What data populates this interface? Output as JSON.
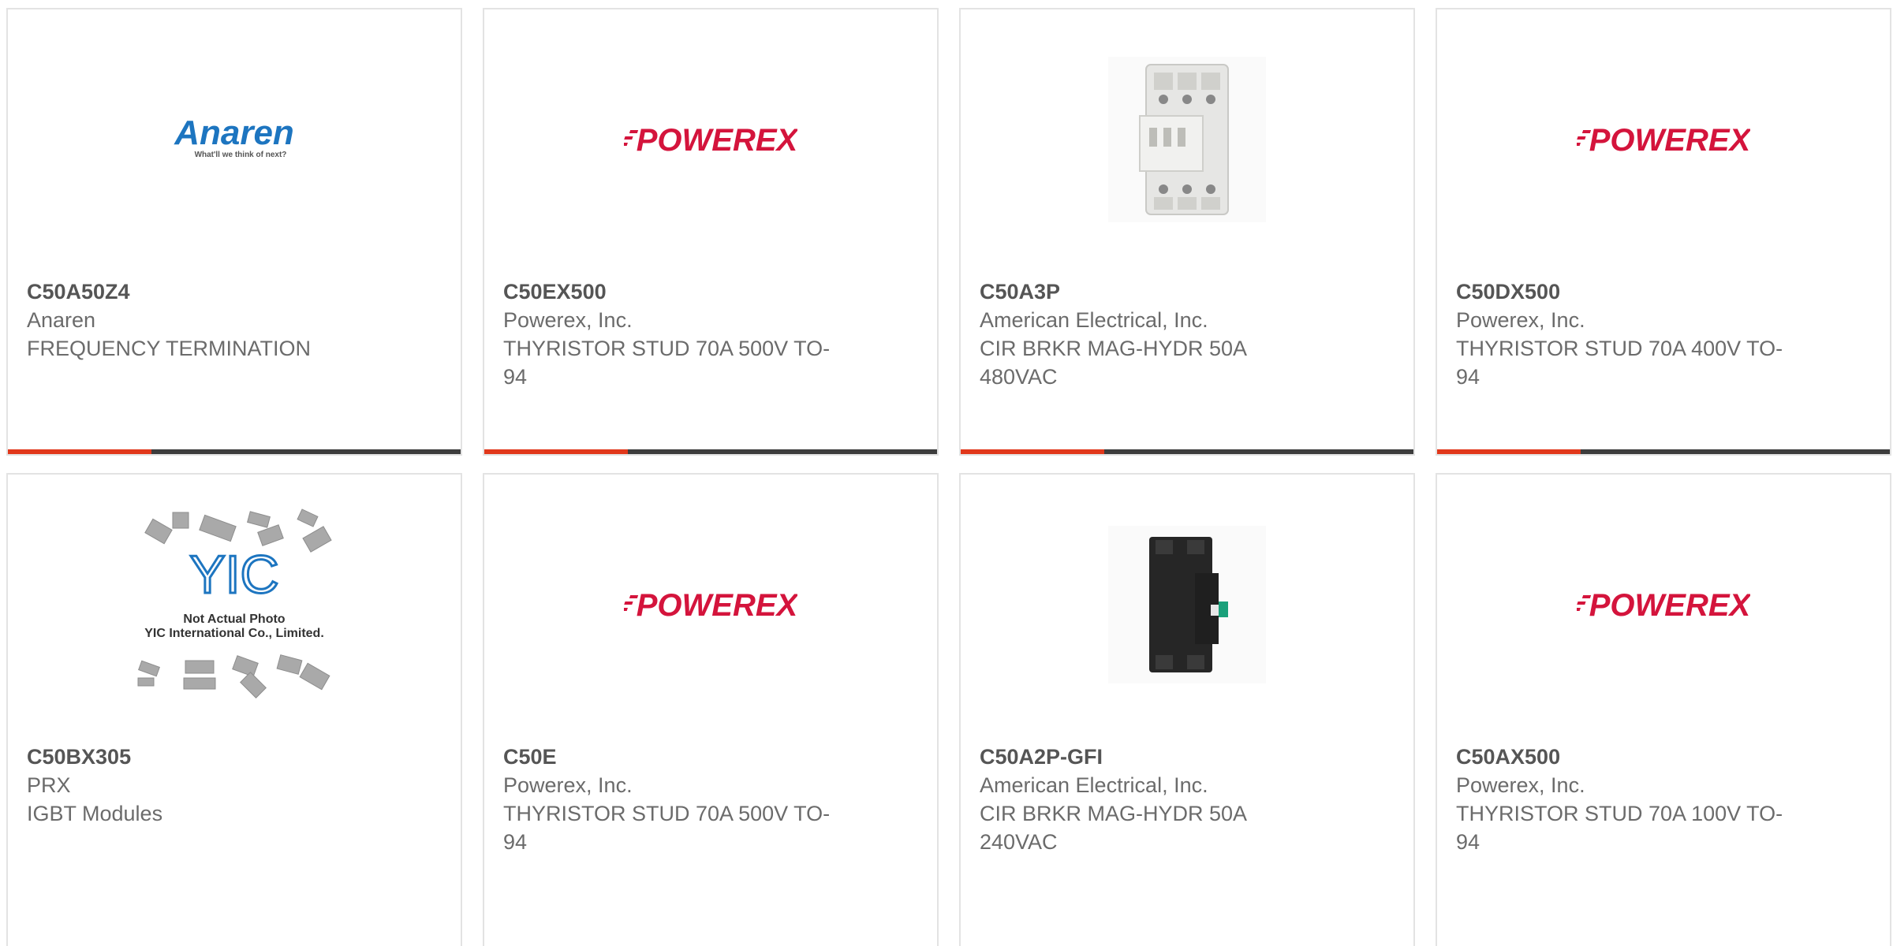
{
  "colors": {
    "accent": "#e1381b",
    "bar": "#3d3d3d",
    "border": "#e3e3e3",
    "powerex_red": "#d4143c",
    "anaren_blue": "#1d75c0"
  },
  "products": [
    {
      "part_number": "C50A50Z4",
      "manufacturer": "Anaren",
      "description": "FREQUENCY TERMINATION",
      "image": "anaren-logo",
      "logo_text": "Anaren",
      "logo_tagline": "What'll we think of next?"
    },
    {
      "part_number": "C50EX500",
      "manufacturer": "Powerex, Inc.",
      "description": "THYRISTOR STUD 70A 500V TO-94",
      "image": "powerex-logo",
      "logo_text": "POWEREX"
    },
    {
      "part_number": "C50A3P",
      "manufacturer": "American Electrical, Inc.",
      "description": "CIR BRKR MAG-HYDR 50A 480VAC",
      "image": "breaker-3pole-white-photo"
    },
    {
      "part_number": "C50DX500",
      "manufacturer": "Powerex, Inc.",
      "description": "THYRISTOR STUD 70A 400V TO-94",
      "image": "powerex-logo",
      "logo_text": "POWEREX"
    },
    {
      "part_number": "C50BX305",
      "manufacturer": "PRX",
      "description": "IGBT Modules",
      "image": "yic-placeholder",
      "logo_text": "YIC",
      "placeholder_line1": "Not Actual Photo",
      "placeholder_line2": "YIC International Co., Limited."
    },
    {
      "part_number": "C50E",
      "manufacturer": "Powerex, Inc.",
      "description": "THYRISTOR STUD 70A 500V TO-94",
      "image": "powerex-logo",
      "logo_text": "POWEREX"
    },
    {
      "part_number": "C50A2P-GFI",
      "manufacturer": "American Electrical, Inc.",
      "description": "CIR BRKR MAG-HYDR 50A 240VAC",
      "image": "breaker-2pole-black-photo"
    },
    {
      "part_number": "C50AX500",
      "manufacturer": "Powerex, Inc.",
      "description": "THYRISTOR STUD 70A 100V TO-94",
      "image": "powerex-logo",
      "logo_text": "POWEREX"
    }
  ]
}
